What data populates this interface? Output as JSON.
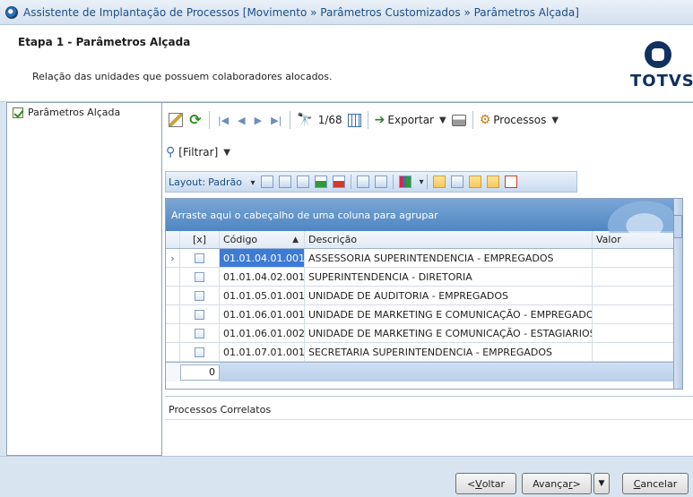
{
  "window": {
    "title": "Assistente de Implantação de Processos [Movimento » Parâmetros Customizados  » Parâmetros Alçada]"
  },
  "header": {
    "step_title": "Etapa 1 - Parâmetros Alçada",
    "step_description": "Relação das unidades que possuem colaboradores alocados.",
    "logo_text": "TOTVS"
  },
  "sidebar": {
    "items": [
      {
        "label": "Parâmetros Alçada",
        "icon": "check-document-icon"
      }
    ]
  },
  "toolbar": {
    "record_position": "1/68",
    "export_label": "Exportar",
    "processes_label": "Processos"
  },
  "filter": {
    "label": "[Filtrar]"
  },
  "layout_bar": {
    "label": "Layout:",
    "preset": "Padrão"
  },
  "grid": {
    "group_hint": "Arraste aqui o cabeçalho de uma coluna para agrupar",
    "columns": {
      "check": "[x]",
      "code": "Código",
      "description": "Descrição",
      "value": "Valor"
    },
    "rows": [
      {
        "code": "01.01.04.01.001",
        "description": "ASSESSORIA SUPERINTENDENCIA - EMPREGADOS",
        "value": ""
      },
      {
        "code": "01.01.04.02.001",
        "description": "SUPERINTENDENCIA - DIRETORIA",
        "value": ""
      },
      {
        "code": "01.01.05.01.001",
        "description": "UNIDADE DE AUDITORIA - EMPREGADOS",
        "value": ""
      },
      {
        "code": "01.01.06.01.001",
        "description": "UNIDADE DE MARKETING E COMUNICAÇÃO - EMPREGADOS",
        "value": ""
      },
      {
        "code": "01.01.06.01.002",
        "description": "UNIDADE DE MARKETING E COMUNICAÇÃO - ESTAGIARIOS",
        "value": ""
      },
      {
        "code": "01.01.07.01.001",
        "description": "SECRETARIA SUPERINTENDENCIA - EMPREGADOS",
        "value": ""
      }
    ],
    "selected_count": "0"
  },
  "related": {
    "title": "Processos Correlatos"
  },
  "buttons": {
    "back_prefix": "< ",
    "back_underlined": "V",
    "back_rest": "oltar",
    "next_prefix": "Avança",
    "next_underlined": "r",
    "next_suffix": " >",
    "cancel_underlined": "C",
    "cancel_rest": "ancelar"
  },
  "colors": {
    "accent": "#3d7bd6",
    "title_text": "#1a4d8a",
    "window_bg": "#d9e4f1"
  }
}
